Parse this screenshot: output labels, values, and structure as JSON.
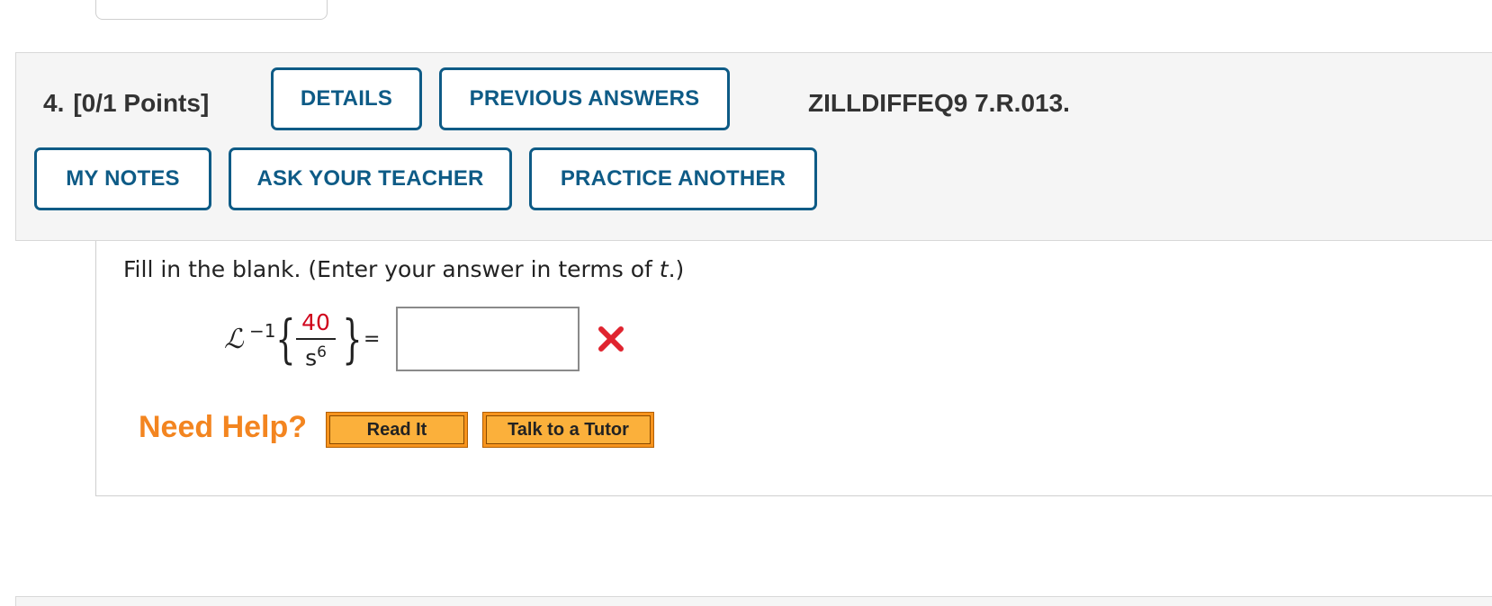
{
  "question": {
    "number": "4.",
    "points": "[0/1 Points]",
    "code": "ZILLDIFFEQ9 7.R.013."
  },
  "toolbar": {
    "details_label": "DETAILS",
    "previous_answers_label": "PREVIOUS ANSWERS",
    "my_notes_label": "MY NOTES",
    "ask_teacher_label": "ASK YOUR TEACHER",
    "practice_another_label": "PRACTICE ANOTHER"
  },
  "body": {
    "instruction_prefix": "Fill in the blank. (Enter your answer in terms of ",
    "instruction_var": "t",
    "instruction_suffix": ".)",
    "expression": {
      "operator": "ℒ",
      "superscript": "−1",
      "numerator": "40",
      "denominator_base": "s",
      "denominator_exponent": "6",
      "equals": "="
    },
    "answer_value": "",
    "answer_status": "incorrect",
    "incorrect_color": "#e0242f"
  },
  "help": {
    "label": "Need Help?",
    "read_it_label": "Read It",
    "talk_tutor_label": "Talk to a Tutor"
  },
  "colors": {
    "accent": "#0e5b86",
    "help_orange": "#f38520",
    "numerator_red": "#d0021b"
  }
}
